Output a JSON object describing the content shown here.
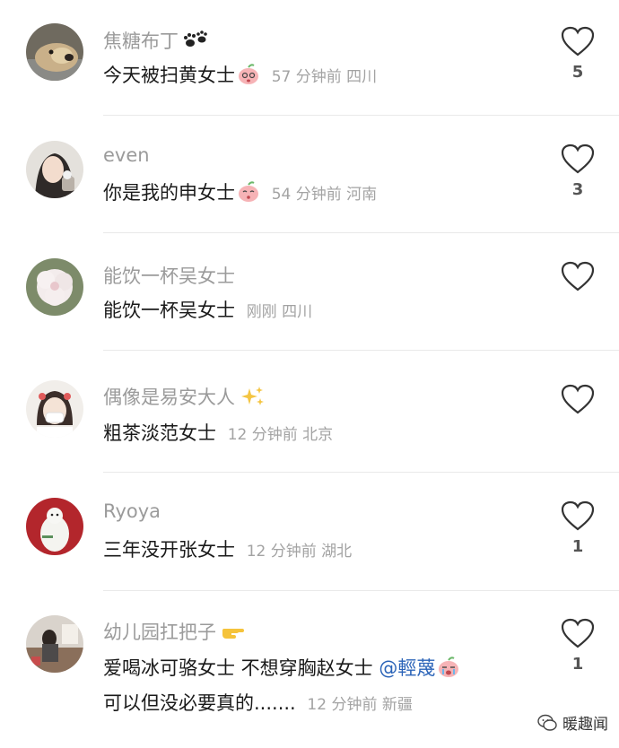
{
  "comments": [
    {
      "username": "焦糖布丁",
      "text": "今天被扫黄女士",
      "meta": "57 分钟前  四川",
      "likes": "5",
      "name_emoji": "paw-prints-icon",
      "text_emoji": "peach-dizzy-emoji-icon"
    },
    {
      "username": "even",
      "text": "你是我的申女士",
      "meta": "54 分钟前  河南",
      "likes": "3",
      "text_emoji": "peach-kiss-emoji-icon"
    },
    {
      "username": "能饮一杯吴女士",
      "text": "能饮一杯吴女士",
      "meta": "刚刚  四川",
      "likes": ""
    },
    {
      "username": "偶像是易安大人",
      "text": "粗茶淡范女士",
      "meta": "12 分钟前  北京",
      "likes": "",
      "name_emoji": "sparkles-icon"
    },
    {
      "username": "Ryoya",
      "text": "三年没开张女士",
      "meta": "12 分钟前  湖北",
      "likes": "1"
    },
    {
      "username": "幼儿园扛把子",
      "text_line1": "爱喝冰可骆女士 不想穿胸赵女士",
      "mention": "@輕蔑",
      "text_line2": "可以但没必要真的.......",
      "meta": "12 分钟前  新疆",
      "likes": "1",
      "name_emoji": "pointing-hand-icon",
      "text_emoji": "peach-crying-emoji-icon"
    }
  ],
  "watermark": "暖趣闻",
  "colors": {
    "username": "#9b9b9b",
    "meta": "#a3a3a3",
    "mention": "#2a63b8",
    "divider": "#e9e9e9"
  }
}
